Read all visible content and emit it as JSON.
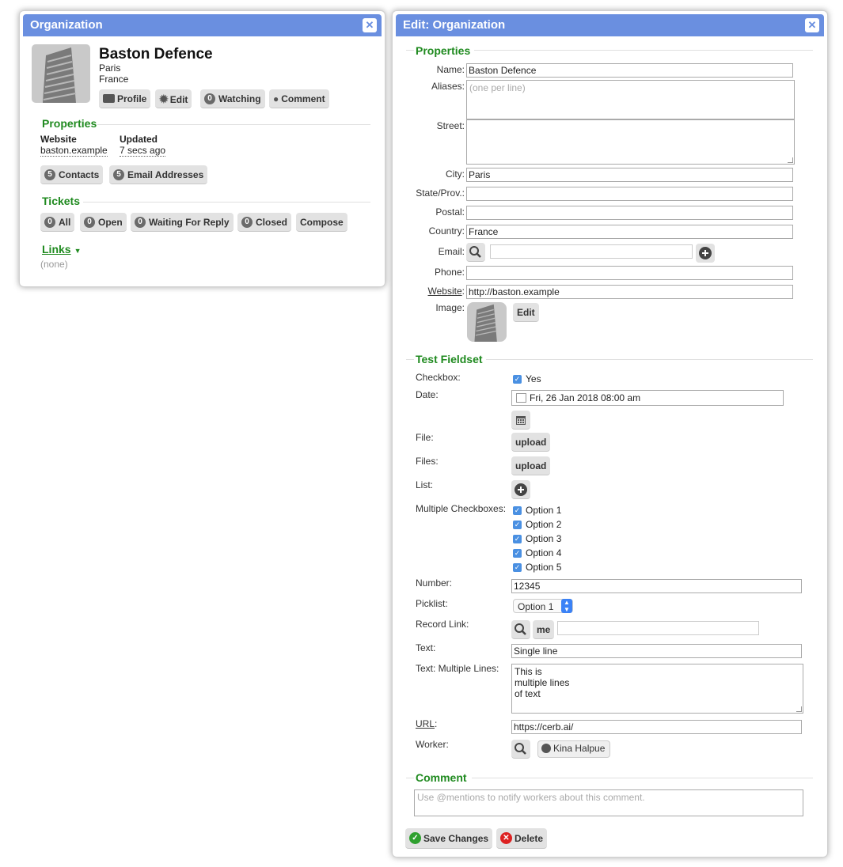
{
  "left_panel": {
    "title": "Organization",
    "org_name": "Baston Defence",
    "city": "Paris",
    "country": "France",
    "actions": {
      "profile": "Profile",
      "edit": "Edit",
      "watching_count": "0",
      "watching": "Watching",
      "comment": "Comment"
    },
    "properties_heading": "Properties",
    "props": {
      "website_label": "Website",
      "website_value": "baston.example",
      "updated_label": "Updated",
      "updated_value": "7 secs ago"
    },
    "contacts_count": "5",
    "contacts": "Contacts",
    "emails_count": "5",
    "emails": "Email Addresses",
    "tickets_heading": "Tickets",
    "tickets": {
      "all_count": "0",
      "all": "All",
      "open_count": "0",
      "open": "Open",
      "waiting_count": "0",
      "waiting": "Waiting For Reply",
      "closed_count": "0",
      "closed": "Closed",
      "compose": "Compose"
    },
    "links_heading": "Links",
    "links_none": "(none)"
  },
  "edit_panel": {
    "title": "Edit: Organization",
    "properties_heading": "Properties",
    "fields": {
      "name_label": "Name:",
      "name_value": "Baston Defence",
      "aliases_label": "Aliases:",
      "aliases_placeholder": "(one per line)",
      "street_label": "Street:",
      "city_label": "City:",
      "city_value": "Paris",
      "state_label": "State/Prov.:",
      "postal_label": "Postal:",
      "country_label": "Country:",
      "country_value": "France",
      "email_label": "Email:",
      "phone_label": "Phone:",
      "website_label": "Website",
      "website_colon": ":",
      "website_value": "http://baston.example",
      "image_label": "Image:",
      "image_edit": "Edit"
    },
    "test_heading": "Test Fieldset",
    "test": {
      "checkbox_label": "Checkbox:",
      "checkbox_value": "Yes",
      "date_label": "Date:",
      "date_value": "Fri, 26 Jan 2018 08:00 am",
      "file_label": "File:",
      "file_btn": "upload",
      "files_label": "Files:",
      "files_btn": "upload",
      "list_label": "List:",
      "multi_label": "Multiple Checkboxes:",
      "multi_options": [
        "Option 1",
        "Option 2",
        "Option 3",
        "Option 4",
        "Option 5"
      ],
      "number_label": "Number:",
      "number_value": "12345",
      "picklist_label": "Picklist:",
      "picklist_value": "Option 1",
      "record_label": "Record Link:",
      "record_me": "me",
      "text_label": "Text:",
      "text_value": "Single line",
      "textml_label": "Text: Multiple Lines:",
      "textml_lines": [
        "This is",
        "multiple lines",
        "of text"
      ],
      "url_label": "URL",
      "url_colon": ":",
      "url_value": "https://cerb.ai/",
      "worker_label": "Worker:",
      "worker_value": "Kina Halpue"
    },
    "comment_heading": "Comment",
    "comment_placeholder": "Use @mentions to notify workers about this comment.",
    "save": "Save Changes",
    "delete": "Delete"
  }
}
